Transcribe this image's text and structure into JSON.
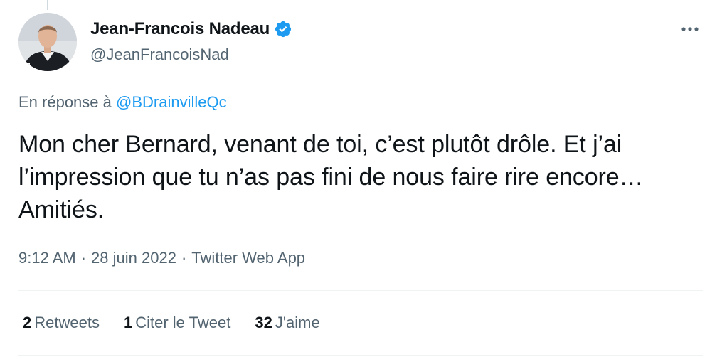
{
  "author": {
    "display_name": "Jean-Francois Nadeau",
    "handle": "@JeanFrancoisNad",
    "verified": true,
    "avatar_icon": "profile-photo"
  },
  "reply": {
    "prefix": "En réponse à",
    "mention": "@BDrainvilleQc"
  },
  "tweet": {
    "text": "Mon cher Bernard, venant de toi, c’est plutôt drôle. Et j’ai l’impression que tu n’as pas fini de nous faire rire encore… Amitiés."
  },
  "meta": {
    "time": "9:12 AM",
    "separator": "·",
    "date": "28 juin 2022",
    "source": "Twitter Web App"
  },
  "stats": [
    {
      "count": "2",
      "label": "Retweets"
    },
    {
      "count": "1",
      "label": "Citer le Tweet"
    },
    {
      "count": "32",
      "label": "J'aime"
    }
  ],
  "colors": {
    "accent": "#1d9bf0",
    "text": "#0f1419",
    "secondary": "#536471",
    "divider": "#eff3f4"
  }
}
